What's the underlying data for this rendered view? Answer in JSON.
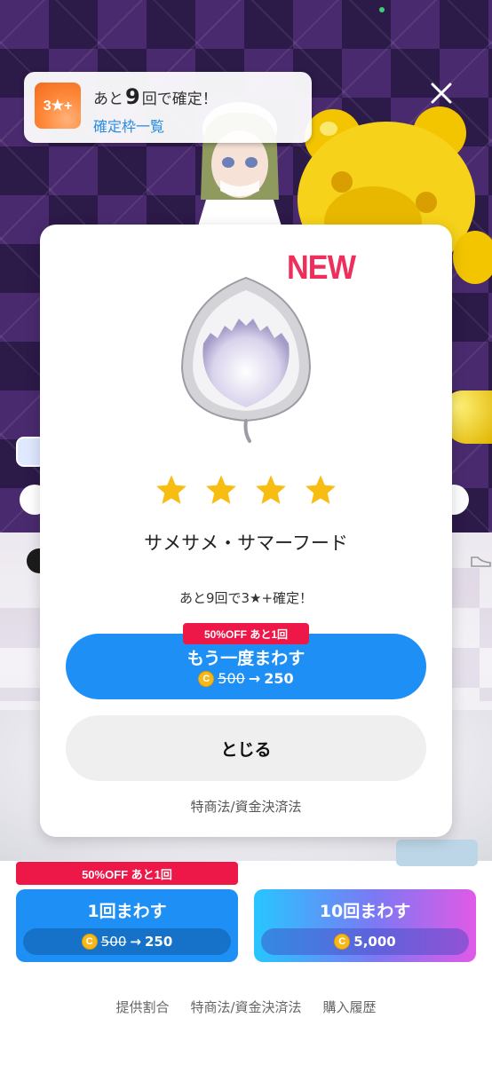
{
  "banner": {
    "badge": "3★+",
    "prefix": "あと",
    "count": "9",
    "suffix": "回で確定！",
    "link": "確定枠一覧"
  },
  "dialog": {
    "new_badge": "NEW",
    "stars": 4,
    "item_name": "サメサメ・サマーフード",
    "guarantee_text": "あと9回で3★+確定！",
    "offer_tag": "50%OFF あと1回",
    "spin_again_label": "もう一度まわす",
    "spin_again_old_price": "500",
    "spin_again_arrow": "→",
    "spin_again_new_price": "250",
    "close_label": "とじる",
    "law_link": "特商法/資金決済法"
  },
  "bottom": {
    "offer_tag": "50%OFF あと1回",
    "spin1_label": "1回まわす",
    "spin1_old_price": "500",
    "spin1_arrow": "→",
    "spin1_new_price": "250",
    "spin10_label": "10回まわす",
    "spin10_price": "5,000"
  },
  "footer": {
    "rates": "提供割合",
    "law": "特商法/資金決済法",
    "history": "購入履歴"
  },
  "coin_symbol": "C",
  "colors": {
    "primary_blue": "#1e90f5",
    "offer_red": "#ee1848",
    "new_pink": "#ee2e5c",
    "star_yellow": "#f7bd12",
    "coin_gold": "#f6b81b"
  }
}
